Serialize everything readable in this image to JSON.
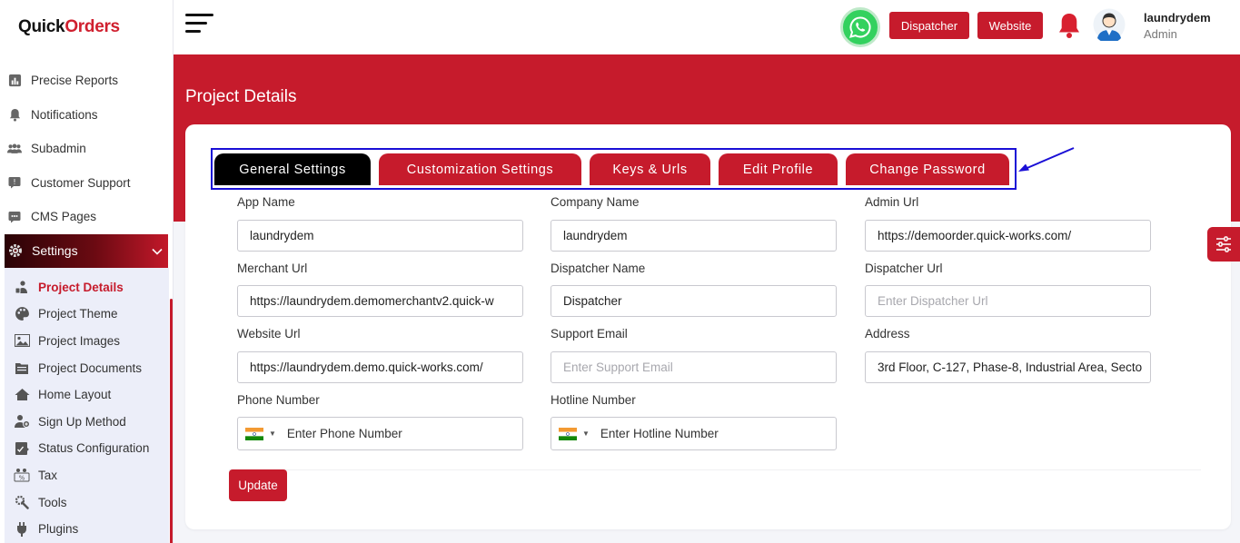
{
  "brand": {
    "logo_part1": "Quick",
    "logo_part2": "Orders"
  },
  "sidebar": {
    "items": [
      {
        "label": "Precise Reports",
        "icon": "report-icon"
      },
      {
        "label": "Notifications",
        "icon": "bell-icon"
      },
      {
        "label": "Subadmin",
        "icon": "users-icon"
      },
      {
        "label": "Customer Support",
        "icon": "support-icon"
      },
      {
        "label": "CMS Pages",
        "icon": "cms-icon"
      }
    ],
    "settings_label": "Settings",
    "submenu": [
      {
        "label": "Project Details",
        "icon": "project-details-icon",
        "active": true
      },
      {
        "label": "Project Theme",
        "icon": "palette-icon"
      },
      {
        "label": "Project Images",
        "icon": "image-icon"
      },
      {
        "label": "Project Documents",
        "icon": "documents-icon"
      },
      {
        "label": "Home Layout",
        "icon": "home-icon"
      },
      {
        "label": "Sign Up Method",
        "icon": "signup-icon"
      },
      {
        "label": "Status Configuration",
        "icon": "status-icon"
      },
      {
        "label": "Tax",
        "icon": "tax-icon"
      },
      {
        "label": "Tools",
        "icon": "tools-icon"
      },
      {
        "label": "Plugins",
        "icon": "plug-icon"
      }
    ]
  },
  "header": {
    "dispatcher_label": "Dispatcher",
    "website_label": "Website",
    "user_name": "laundrydem",
    "user_role": "Admin"
  },
  "page": {
    "title": "Project Details"
  },
  "tabs": [
    {
      "label": "General Settings",
      "active": true
    },
    {
      "label": "Customization Settings"
    },
    {
      "label": "Keys & Urls"
    },
    {
      "label": "Edit Profile"
    },
    {
      "label": "Change Password"
    }
  ],
  "form": {
    "app_name": {
      "label": "App Name",
      "value": "laundrydem"
    },
    "company_name": {
      "label": "Company Name",
      "value": "laundrydem"
    },
    "admin_url": {
      "label": "Admin Url",
      "value": "https://demoorder.quick-works.com/"
    },
    "merchant_url": {
      "label": "Merchant Url",
      "value": "https://laundrydem.demomerchantv2.quick-w"
    },
    "dispatcher_name": {
      "label": "Dispatcher Name",
      "value": "Dispatcher"
    },
    "dispatcher_url": {
      "label": "Dispatcher Url",
      "placeholder": "Enter Dispatcher Url"
    },
    "website_url": {
      "label": "Website Url",
      "value": "https://laundrydem.demo.quick-works.com/"
    },
    "support_email": {
      "label": "Support Email",
      "placeholder": "Enter Support Email"
    },
    "address": {
      "label": "Address",
      "value": "3rd Floor, C-127, Phase-8, Industrial Area, Secto"
    },
    "phone_number": {
      "label": "Phone Number",
      "placeholder": "Enter Phone Number"
    },
    "hotline_number": {
      "label": "Hotline Number",
      "placeholder": "Enter Hotline Number"
    },
    "update_label": "Update"
  },
  "colors": {
    "accent": "#c61b2c",
    "highlight_box": "#1a0fd6",
    "whatsapp": "#33d15e"
  }
}
